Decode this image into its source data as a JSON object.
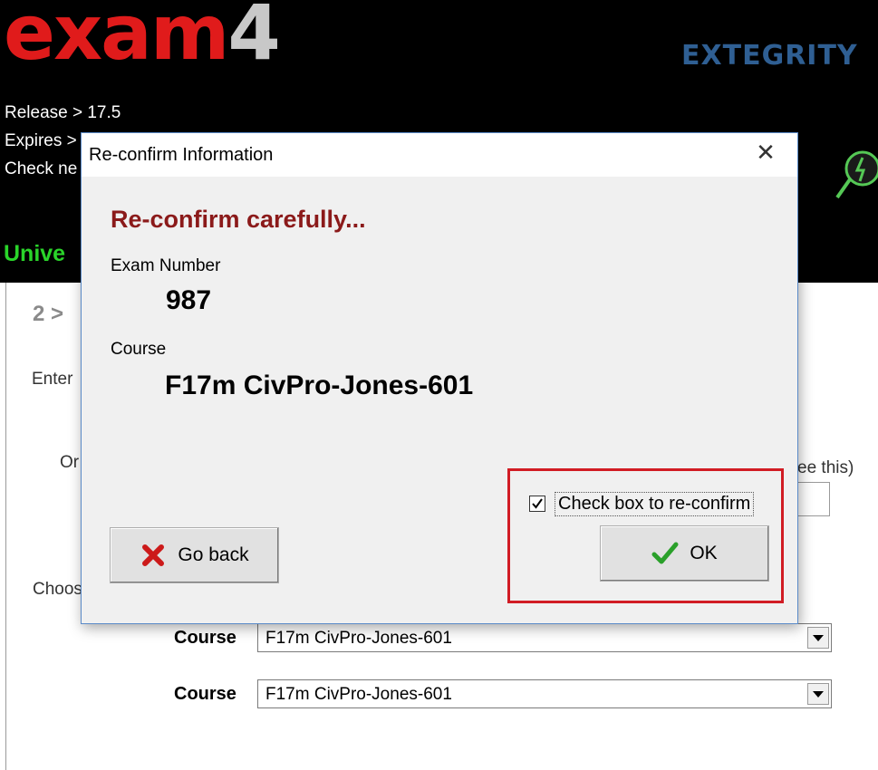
{
  "app": {
    "logo_main": "exam",
    "logo_digit": "4",
    "brand": "EXTEGRITY",
    "info_lines": [
      "Release > 17.5",
      "Expires >",
      "Check ne"
    ],
    "institution_partial": "Unive",
    "step_partial": "2 >",
    "enter_partial": "Enter",
    "or_partial": "Or",
    "see_this_partial": "ee this)",
    "choose_partial": "Choos",
    "course_label": "Course",
    "course_selects": [
      "F17m CivPro-Jones-601",
      "F17m CivPro-Jones-601"
    ]
  },
  "dialog": {
    "title": "Re-confirm Information",
    "heading": "Re-confirm carefully...",
    "exam_number_label": "Exam Number",
    "exam_number": "987",
    "course_label": "Course",
    "course_value": "F17m CivPro-Jones-601",
    "checkbox_label": "Check box to re-confirm",
    "checkbox_checked": true,
    "go_back_label": "Go back",
    "ok_label": "OK",
    "highlight_color": "#d11c24"
  },
  "colors": {
    "logo_red": "#e01b1b",
    "brand_blue": "#2f5f93",
    "univ_green": "#2ad42a",
    "heading_red": "#8b1a1a"
  }
}
